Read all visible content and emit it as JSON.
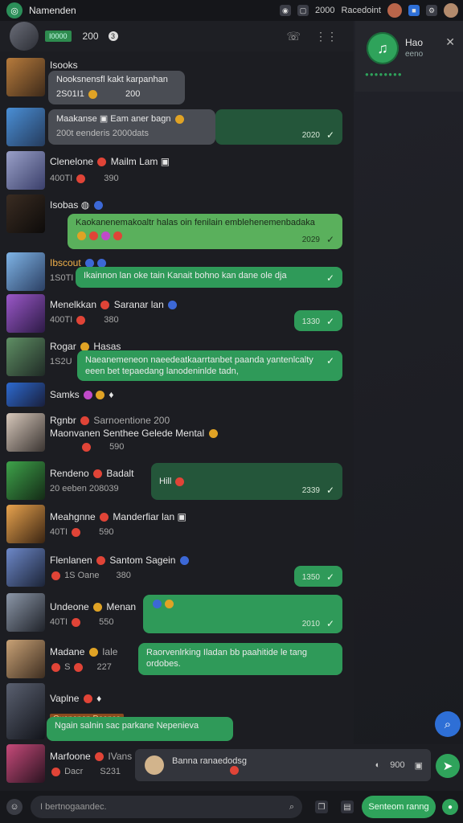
{
  "window": {
    "title": "Namenden",
    "top_right_text": "Racedoint",
    "top_time": "2000"
  },
  "header": {
    "badge": "I0000",
    "count": "200",
    "dot": "3"
  },
  "side": {
    "name": "Hao",
    "status": "eeno",
    "dots": "●●●●●●●●"
  },
  "rows": [
    {
      "name": "Isooks",
      "meta": "",
      "bubble": "Nooksnensfl kakt karpanhan",
      "bubble_meta": "2S01I1",
      "bubble_time": "200"
    },
    {
      "name": "Maakanse",
      "meta": "",
      "bubble": "Eam aner bagn",
      "bubble_meta": "200t eenderis 2000dats",
      "bubble_time": "2020"
    },
    {
      "name": "Clenelone",
      "meta": "400TI",
      "note": "Mailm Lam",
      "time2": "390",
      "bubble": "",
      "bubble_time": ""
    },
    {
      "name": "Isobas",
      "meta": "",
      "bubble": "Kaokanenemakoaltr halas oin fenilain emblehenemenbadaka",
      "bubble_time": "2029"
    },
    {
      "name": "Ibscout",
      "meta": "1S0TI",
      "bubble": "Ikainnon lan oke tain  Kanait bohno kan dane ole dja",
      "bubble_time": ""
    },
    {
      "name": "Menelkkan",
      "meta": "400TI",
      "note": "Saranar lan",
      "time2": "380",
      "bubble_time": "1330"
    },
    {
      "name": "Rogar",
      "meta": "1S2U",
      "note": "Hasas",
      "bubble": "Naeanemeneon naeedeatkaarrtanbet paanda yantenlcalty",
      "bubble2": "eeen bet tepaedang lanodeninlde tadn,",
      "bubble_time": ""
    },
    {
      "name": "Samks",
      "meta": "",
      "bubble_time": ""
    },
    {
      "name": "Rgnbr",
      "meta": "Maonvanen",
      "note": "Sarnoentione 200",
      "note2": "Senthee Gelede Mental",
      "time2": "590"
    },
    {
      "name": "Rendeno",
      "meta": "20 eeben 208039",
      "note": "Badalt",
      "bubble": "Hill",
      "bubble_time": "2339"
    },
    {
      "name": "Meahgnne",
      "meta": "40TI",
      "note": "Manderfiar lan",
      "time2": "590"
    },
    {
      "name": "Flenlanen",
      "meta": "1S Oane",
      "note": "Santom Sagein",
      "time2": "380",
      "bubble_time": "1350"
    },
    {
      "name": "Undeone",
      "meta": "40TI",
      "note": "Menan",
      "time2": "550",
      "bubble_time": "2010"
    },
    {
      "name": "Madane",
      "meta": "S",
      "note": "Iale",
      "time2": "227",
      "bubble": "Raorvenlrking Iladan bb paahitide le tang",
      "bubble2": "ordobes."
    },
    {
      "name": "Vaplne",
      "meta": "",
      "tag": "Ouanenon Deance",
      "bubble": "Ngain salnin sac parkane Nepenieva"
    },
    {
      "name": "Marfoone",
      "meta": "Dacr",
      "note": "IVans",
      "time2": "S231"
    }
  ],
  "composer": {
    "text": "Banna ranaedodsg",
    "time": "900"
  },
  "bottom": {
    "search_placeholder": "I bertnogaandec.",
    "action_label": "Senteom ranng"
  },
  "colors": {
    "accent": "#2fa35b",
    "bubble_gray": "#4a4d54",
    "bubble_dark_green": "#24563a"
  }
}
